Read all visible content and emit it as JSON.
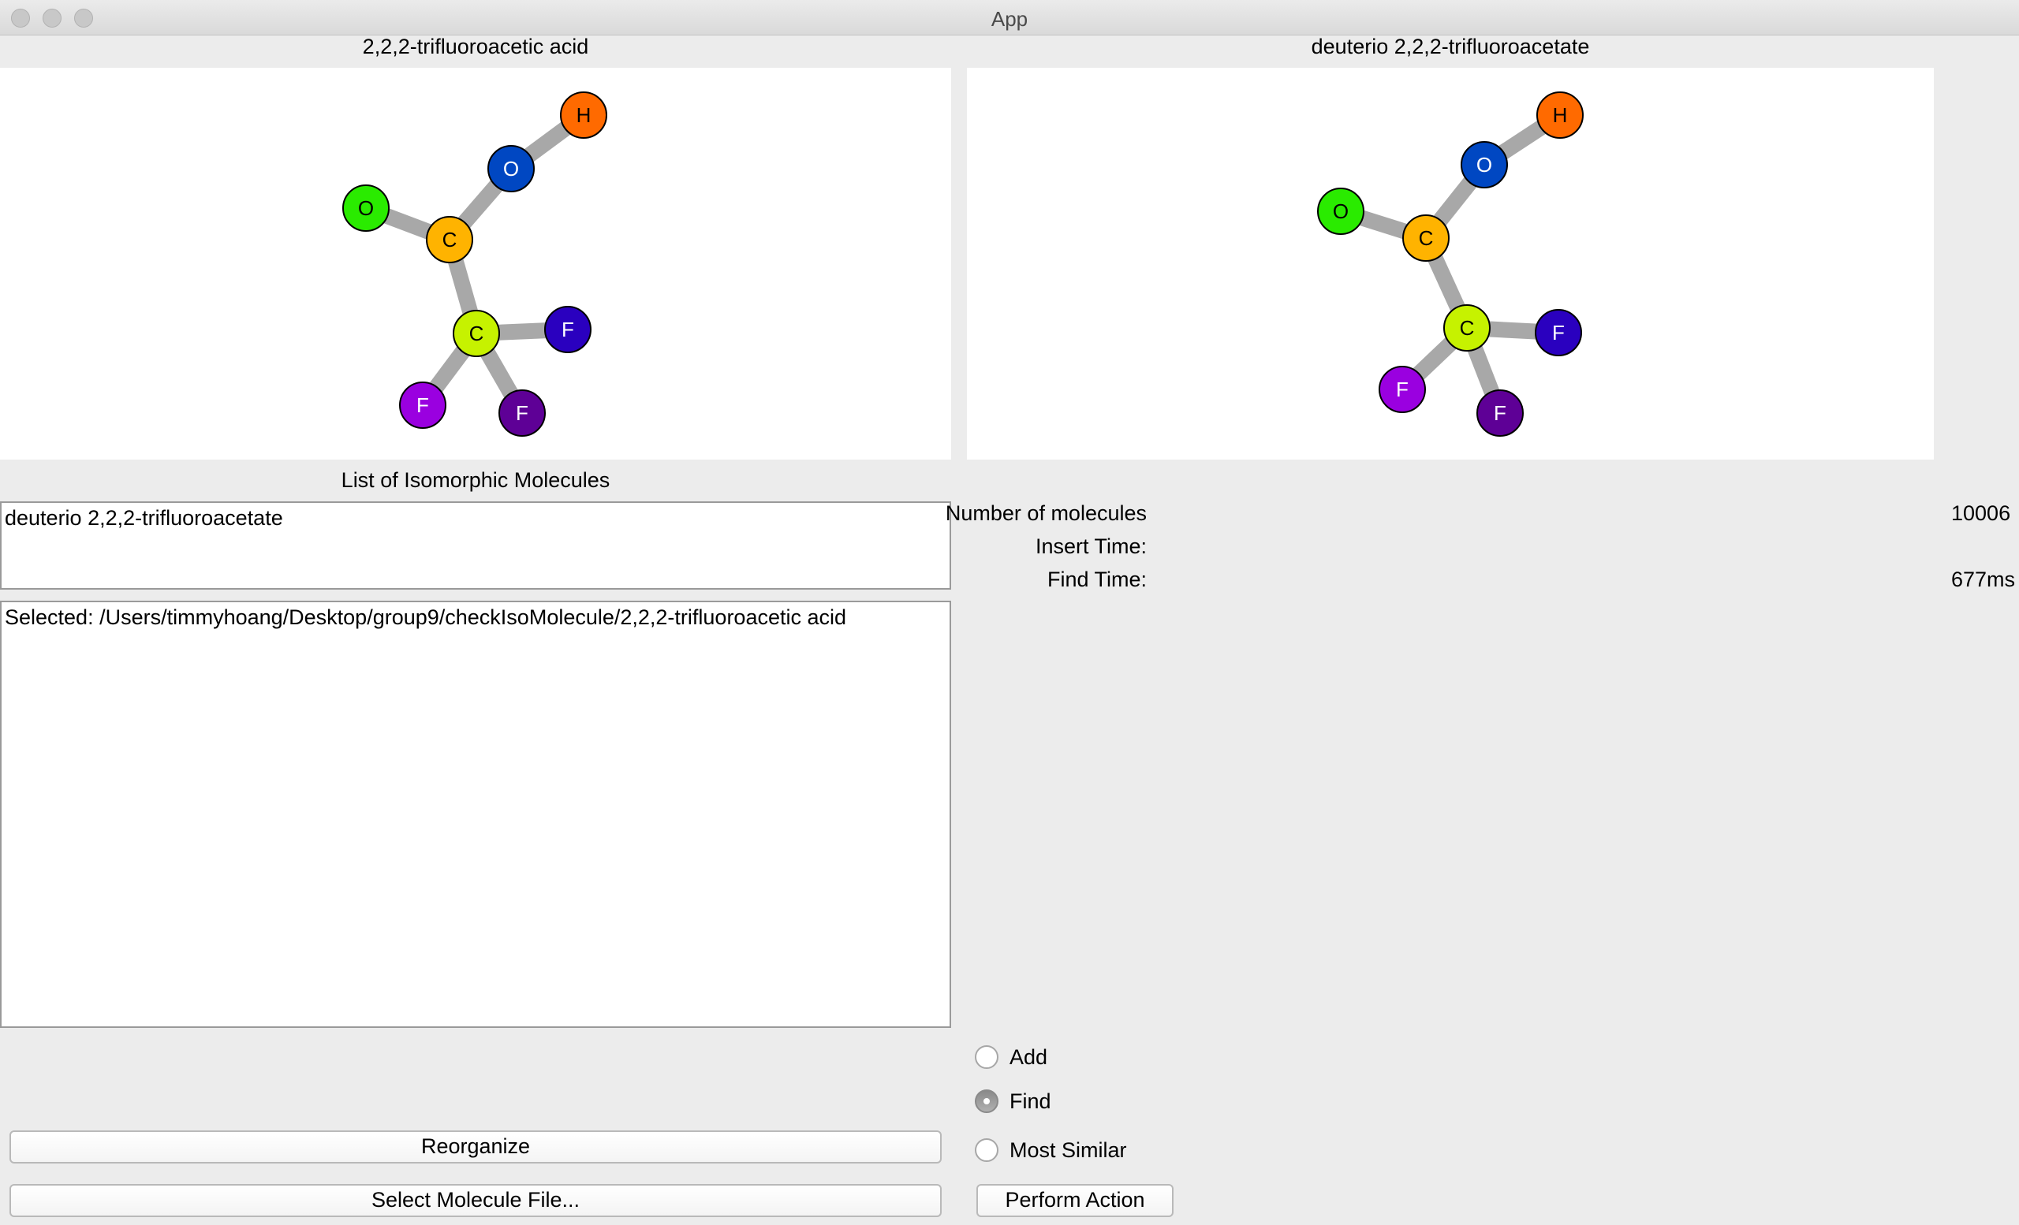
{
  "window": {
    "title": "App"
  },
  "left_panel": {
    "title": "2,2,2-trifluoroacetic acid",
    "atoms": [
      {
        "symbol": "O",
        "color": "#2aeb00"
      },
      {
        "symbol": "C",
        "color": "#ffb300"
      },
      {
        "symbol": "O",
        "color": "#0047c2"
      },
      {
        "symbol": "H",
        "color": "#ff6a00"
      },
      {
        "symbol": "C",
        "color": "#c6f200"
      },
      {
        "symbol": "F",
        "color": "#2a00bf"
      },
      {
        "symbol": "F",
        "color": "#9a00e0"
      },
      {
        "symbol": "F",
        "color": "#5e0096"
      }
    ]
  },
  "right_panel": {
    "title": "deuterio 2,2,2-trifluoroacetate",
    "atoms": [
      {
        "symbol": "O",
        "color": "#2aeb00"
      },
      {
        "symbol": "C",
        "color": "#ffb300"
      },
      {
        "symbol": "O",
        "color": "#0047c2"
      },
      {
        "symbol": "H",
        "color": "#ff6a00"
      },
      {
        "symbol": "C",
        "color": "#c6f200"
      },
      {
        "symbol": "F",
        "color": "#2a00bf"
      },
      {
        "symbol": "F",
        "color": "#9a00e0"
      },
      {
        "symbol": "F",
        "color": "#5e0096"
      }
    ]
  },
  "isomorphic": {
    "heading": "List of Isomorphic Molecules",
    "items": [
      "deuterio 2,2,2-trifluoroacetate"
    ]
  },
  "log": {
    "text": "Selected: /Users/timmyhoang/Desktop/group9/checkIsoMolecule/2,2,2-trifluoroacetic acid"
  },
  "stats": {
    "num_molecules_label": "Number of molecules",
    "num_molecules_value": "10006",
    "insert_time_label": "Insert Time:",
    "insert_time_value": "",
    "find_time_label": "Find Time:",
    "find_time_value": "677ms"
  },
  "buttons": {
    "reorganize": "Reorganize",
    "select_file": "Select Molecule File...",
    "perform_action": "Perform Action"
  },
  "actions": {
    "add_label": "Add",
    "find_label": "Find",
    "most_similar_label": "Most Similar",
    "selected": "Find"
  }
}
